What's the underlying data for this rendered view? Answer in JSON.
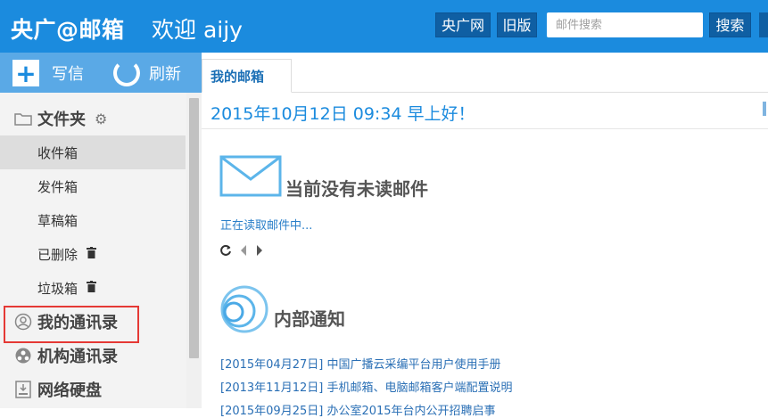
{
  "header": {
    "brand": "央广@邮箱",
    "welcome": "欢迎 aijy",
    "link_cnr": "央广网",
    "link_old": "旧版",
    "search_placeholder": "邮件搜索",
    "search_button": "搜索"
  },
  "toolbar": {
    "compose": "写信",
    "refresh": "刷新"
  },
  "sidebar": {
    "folders_label": "文件夹",
    "items": [
      {
        "label": "收件箱"
      },
      {
        "label": "发件箱"
      },
      {
        "label": "草稿箱"
      },
      {
        "label": "已删除"
      },
      {
        "label": "垃圾箱"
      }
    ],
    "contacts": "我的通讯录",
    "org_contacts": "机构通讯录",
    "net_disk": "网络硬盘"
  },
  "tabs": {
    "active": "我的邮箱"
  },
  "main": {
    "greeting": "2015年10月12日 09:34  早上好！",
    "no_unread": "当前没有未读邮件",
    "reading": "正在读取邮件中...",
    "notices_title": "内部通知",
    "notices": [
      "[2015年04月27日] 中国广播云采编平台用户使用手册",
      "[2013年11月12日] 手机邮箱、电脑邮箱客户端配置说明",
      "[2015年09月25日] 办公室2015年台内公开招聘启事"
    ]
  },
  "colors": {
    "header_blue": "#1b8bde",
    "toolbar_blue": "#5aa9e6",
    "highlight_red": "#e53935"
  }
}
